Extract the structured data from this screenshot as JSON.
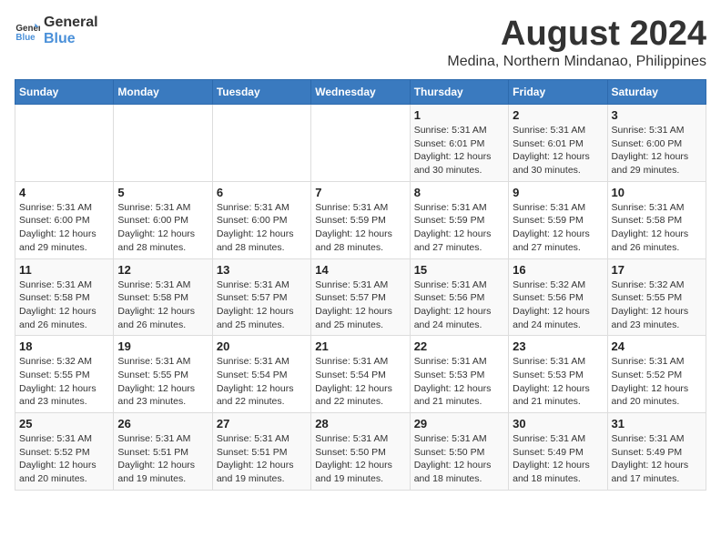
{
  "logo": {
    "line1": "General",
    "line2": "Blue"
  },
  "title": "August 2024",
  "subtitle": "Medina, Northern Mindanao, Philippines",
  "days_of_week": [
    "Sunday",
    "Monday",
    "Tuesday",
    "Wednesday",
    "Thursday",
    "Friday",
    "Saturday"
  ],
  "weeks": [
    [
      {
        "day": "",
        "content": ""
      },
      {
        "day": "",
        "content": ""
      },
      {
        "day": "",
        "content": ""
      },
      {
        "day": "",
        "content": ""
      },
      {
        "day": "1",
        "content": "Sunrise: 5:31 AM\nSunset: 6:01 PM\nDaylight: 12 hours\nand 30 minutes."
      },
      {
        "day": "2",
        "content": "Sunrise: 5:31 AM\nSunset: 6:01 PM\nDaylight: 12 hours\nand 30 minutes."
      },
      {
        "day": "3",
        "content": "Sunrise: 5:31 AM\nSunset: 6:00 PM\nDaylight: 12 hours\nand 29 minutes."
      }
    ],
    [
      {
        "day": "4",
        "content": "Sunrise: 5:31 AM\nSunset: 6:00 PM\nDaylight: 12 hours\nand 29 minutes."
      },
      {
        "day": "5",
        "content": "Sunrise: 5:31 AM\nSunset: 6:00 PM\nDaylight: 12 hours\nand 28 minutes."
      },
      {
        "day": "6",
        "content": "Sunrise: 5:31 AM\nSunset: 6:00 PM\nDaylight: 12 hours\nand 28 minutes."
      },
      {
        "day": "7",
        "content": "Sunrise: 5:31 AM\nSunset: 5:59 PM\nDaylight: 12 hours\nand 28 minutes."
      },
      {
        "day": "8",
        "content": "Sunrise: 5:31 AM\nSunset: 5:59 PM\nDaylight: 12 hours\nand 27 minutes."
      },
      {
        "day": "9",
        "content": "Sunrise: 5:31 AM\nSunset: 5:59 PM\nDaylight: 12 hours\nand 27 minutes."
      },
      {
        "day": "10",
        "content": "Sunrise: 5:31 AM\nSunset: 5:58 PM\nDaylight: 12 hours\nand 26 minutes."
      }
    ],
    [
      {
        "day": "11",
        "content": "Sunrise: 5:31 AM\nSunset: 5:58 PM\nDaylight: 12 hours\nand 26 minutes."
      },
      {
        "day": "12",
        "content": "Sunrise: 5:31 AM\nSunset: 5:58 PM\nDaylight: 12 hours\nand 26 minutes."
      },
      {
        "day": "13",
        "content": "Sunrise: 5:31 AM\nSunset: 5:57 PM\nDaylight: 12 hours\nand 25 minutes."
      },
      {
        "day": "14",
        "content": "Sunrise: 5:31 AM\nSunset: 5:57 PM\nDaylight: 12 hours\nand 25 minutes."
      },
      {
        "day": "15",
        "content": "Sunrise: 5:31 AM\nSunset: 5:56 PM\nDaylight: 12 hours\nand 24 minutes."
      },
      {
        "day": "16",
        "content": "Sunrise: 5:32 AM\nSunset: 5:56 PM\nDaylight: 12 hours\nand 24 minutes."
      },
      {
        "day": "17",
        "content": "Sunrise: 5:32 AM\nSunset: 5:55 PM\nDaylight: 12 hours\nand 23 minutes."
      }
    ],
    [
      {
        "day": "18",
        "content": "Sunrise: 5:32 AM\nSunset: 5:55 PM\nDaylight: 12 hours\nand 23 minutes."
      },
      {
        "day": "19",
        "content": "Sunrise: 5:31 AM\nSunset: 5:55 PM\nDaylight: 12 hours\nand 23 minutes."
      },
      {
        "day": "20",
        "content": "Sunrise: 5:31 AM\nSunset: 5:54 PM\nDaylight: 12 hours\nand 22 minutes."
      },
      {
        "day": "21",
        "content": "Sunrise: 5:31 AM\nSunset: 5:54 PM\nDaylight: 12 hours\nand 22 minutes."
      },
      {
        "day": "22",
        "content": "Sunrise: 5:31 AM\nSunset: 5:53 PM\nDaylight: 12 hours\nand 21 minutes."
      },
      {
        "day": "23",
        "content": "Sunrise: 5:31 AM\nSunset: 5:53 PM\nDaylight: 12 hours\nand 21 minutes."
      },
      {
        "day": "24",
        "content": "Sunrise: 5:31 AM\nSunset: 5:52 PM\nDaylight: 12 hours\nand 20 minutes."
      }
    ],
    [
      {
        "day": "25",
        "content": "Sunrise: 5:31 AM\nSunset: 5:52 PM\nDaylight: 12 hours\nand 20 minutes."
      },
      {
        "day": "26",
        "content": "Sunrise: 5:31 AM\nSunset: 5:51 PM\nDaylight: 12 hours\nand 19 minutes."
      },
      {
        "day": "27",
        "content": "Sunrise: 5:31 AM\nSunset: 5:51 PM\nDaylight: 12 hours\nand 19 minutes."
      },
      {
        "day": "28",
        "content": "Sunrise: 5:31 AM\nSunset: 5:50 PM\nDaylight: 12 hours\nand 19 minutes."
      },
      {
        "day": "29",
        "content": "Sunrise: 5:31 AM\nSunset: 5:50 PM\nDaylight: 12 hours\nand 18 minutes."
      },
      {
        "day": "30",
        "content": "Sunrise: 5:31 AM\nSunset: 5:49 PM\nDaylight: 12 hours\nand 18 minutes."
      },
      {
        "day": "31",
        "content": "Sunrise: 5:31 AM\nSunset: 5:49 PM\nDaylight: 12 hours\nand 17 minutes."
      }
    ]
  ]
}
